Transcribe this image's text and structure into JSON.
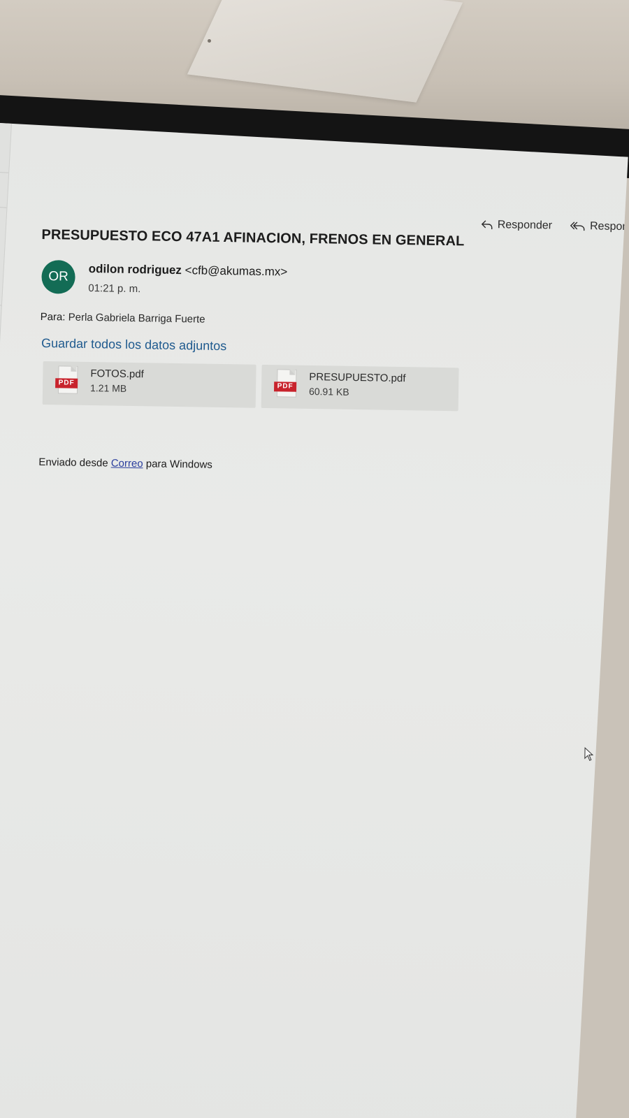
{
  "email": {
    "subject": "PRESUPUESTO ECO 47A1 AFINACION, FRENOS EN GENERAL",
    "actions": {
      "reply_label": "Responder",
      "reply_all_label": "Responde"
    },
    "sender": {
      "initials": "OR",
      "name": "odilon rodriguez",
      "email": "<cfb@akumas.mx>",
      "time": "01:21 p. m.",
      "avatar_color": "#136c55"
    },
    "recipients": {
      "label": "Para:",
      "names": "Perla Gabriela Barriga Fuerte"
    },
    "save_all_label": "Guardar todos los datos adjuntos",
    "attachments": [
      {
        "icon": "pdf-icon",
        "badge": "PDF",
        "name": "FOTOS.pdf",
        "size": "1.21 MB"
      },
      {
        "icon": "pdf-icon",
        "badge": "PDF",
        "name": "PRESUPUESTO.pdf",
        "size": "60.91 KB"
      }
    ],
    "signature": {
      "prefix": "Enviado desde",
      "link": "Correo",
      "suffix": "para Windows"
    }
  },
  "colors": {
    "link_blue": "#1f5a8e",
    "pdf_red": "#c8232c"
  }
}
